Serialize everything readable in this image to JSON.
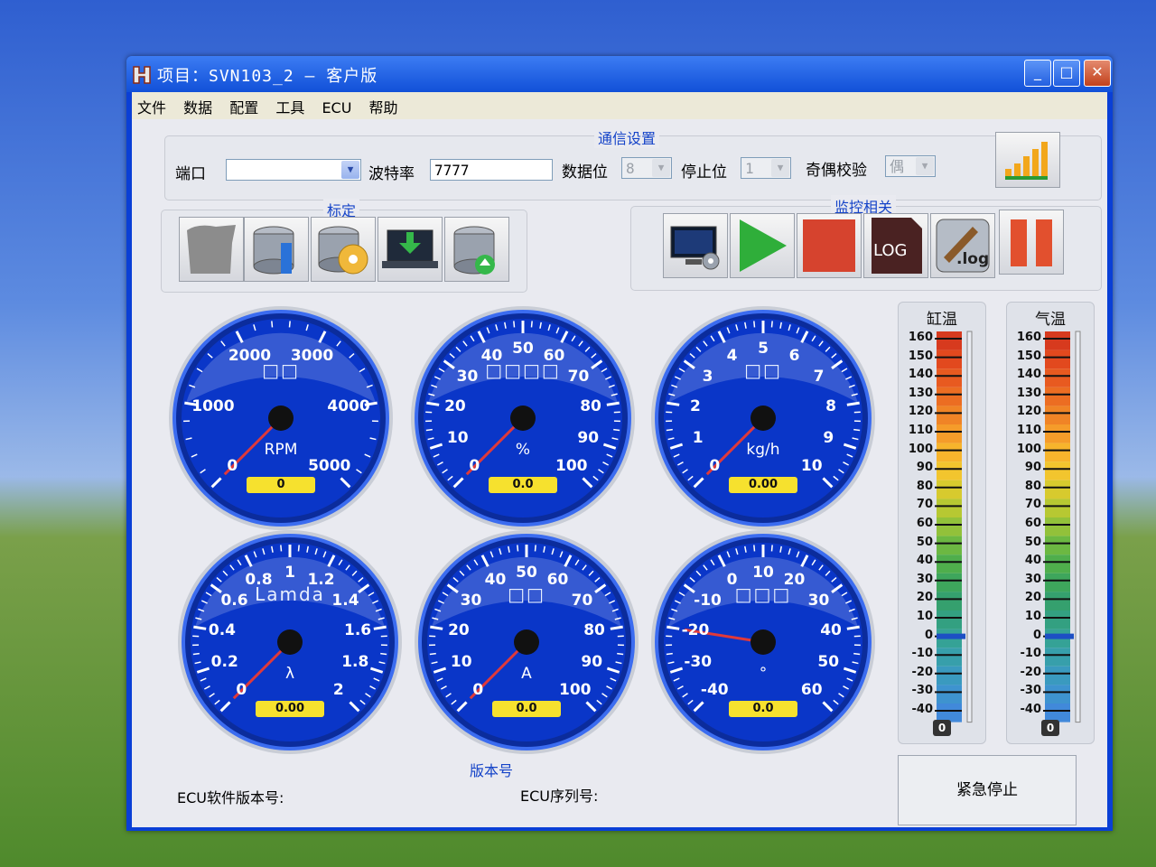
{
  "window": {
    "title": "项目：SVN103_2 — 客户版",
    "controls": {
      "minimize": "_",
      "maximize": "□",
      "close": "✕"
    }
  },
  "menu": [
    "文件",
    "数据",
    "配置",
    "工具",
    "ECU",
    "帮助"
  ],
  "comm": {
    "group_title": "通信设置",
    "port_label": "端口",
    "port_value": "",
    "baud_label": "波特率",
    "baud_value": "7777",
    "databits_label": "数据位",
    "databits_value": "8",
    "stopbits_label": "停止位",
    "stopbits_value": "1",
    "parity_label": "奇偶校验",
    "parity_value": "偶"
  },
  "calibration": {
    "group_title": "标定"
  },
  "monitor": {
    "group_title": "监控相关",
    "log_label": "LOG",
    "log2_label": ".log"
  },
  "gauges": [
    {
      "title": "□□",
      "unit": "RPM",
      "value": "0",
      "value_pct": 0,
      "ticks": [
        "0",
        "1000",
        "2000",
        "3000",
        "4000",
        "5000"
      ]
    },
    {
      "title": "□□□□",
      "unit": "%",
      "value": "0.0",
      "value_pct": 0,
      "ticks": [
        "0",
        "10",
        "20",
        "30",
        "40",
        "50",
        "60",
        "70",
        "80",
        "90",
        "100"
      ]
    },
    {
      "title": "□□",
      "unit": "kg/h",
      "value": "0.00",
      "value_pct": 0,
      "ticks": [
        "0",
        "1",
        "2",
        "3",
        "4",
        "5",
        "6",
        "7",
        "8",
        "9",
        "10"
      ]
    },
    {
      "title": "Lamda",
      "unit": "λ",
      "value": "0.00",
      "value_pct": 0,
      "ticks": [
        "0",
        "0.2",
        "0.4",
        "0.6",
        "0.8",
        "1",
        "1.2",
        "1.4",
        "1.6",
        "1.8",
        "2"
      ]
    },
    {
      "title": "□□",
      "unit": "A",
      "value": "0.0",
      "value_pct": 0,
      "ticks": [
        "0",
        "10",
        "20",
        "30",
        "40",
        "50",
        "60",
        "70",
        "80",
        "90",
        "100"
      ]
    },
    {
      "title": "□□□",
      "unit": "°",
      "value": "0.0",
      "value_pct": 0.2,
      "ticks": [
        "-40",
        "-30",
        "-20",
        "-10",
        "0",
        "10",
        "20",
        "30",
        "40",
        "50",
        "60"
      ]
    }
  ],
  "thermometers": [
    {
      "title": "缸温",
      "value": "0",
      "level": 0
    },
    {
      "title": "气温",
      "value": "0",
      "level": 0
    }
  ],
  "thermo_scale": [
    "160",
    "150",
    "140",
    "130",
    "120",
    "110",
    "100",
    "90",
    "80",
    "70",
    "60",
    "50",
    "40",
    "30",
    "20",
    "10",
    "0",
    "-10",
    "-20",
    "-30",
    "-40"
  ],
  "version": {
    "group_title": "版本号",
    "ecu_sw_label": "ECU软件版本号:",
    "ecu_sn_label": "ECU序列号:"
  },
  "estop_label": "紧急停止",
  "colors": {
    "accent": "#1443c8",
    "gauge_face": "#0a36c8",
    "stop_red": "#d6432e",
    "play_green": "#2fae3a"
  }
}
